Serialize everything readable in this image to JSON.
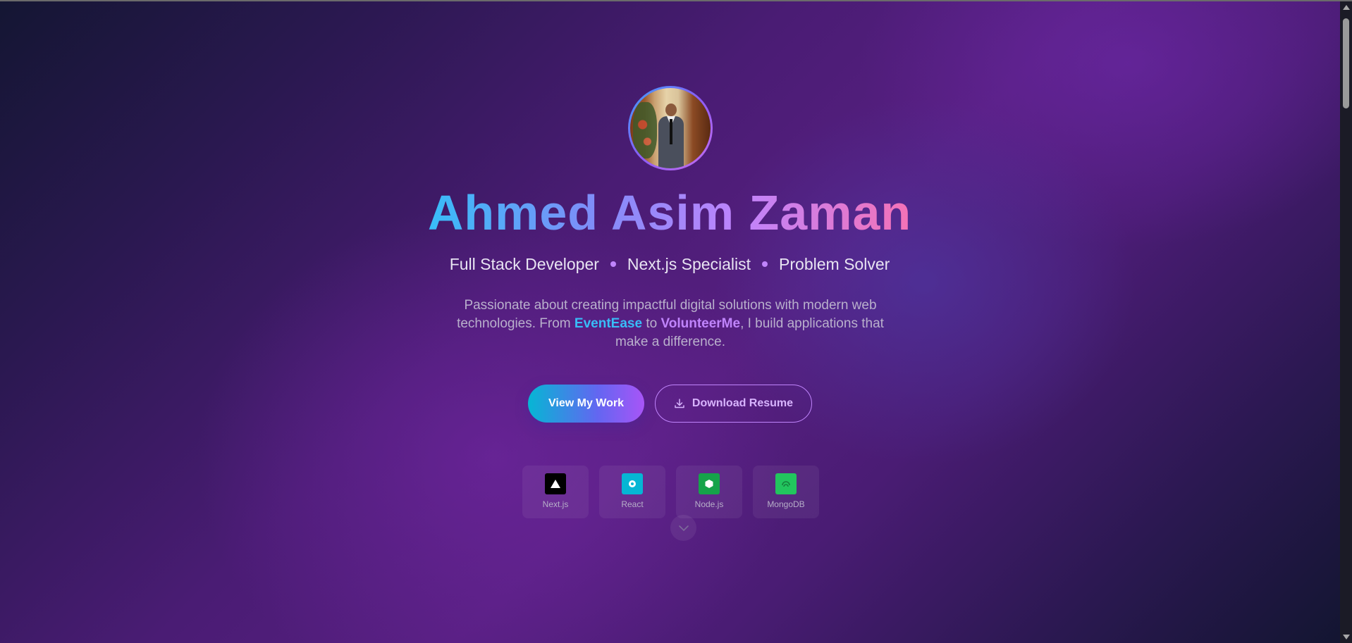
{
  "hero": {
    "name": "Ahmed Asim Zaman",
    "roles": [
      "Full Stack Developer",
      "Next.js Specialist",
      "Problem Solver"
    ],
    "description": {
      "part1": "Passionate about creating impactful digital solutions with modern web technologies. From ",
      "highlight1": "EventEase",
      "part2": " to ",
      "highlight2": "VolunteerMe",
      "part3": ", I build applications that make a difference."
    },
    "primary_button": "View My Work",
    "secondary_button": "Download Resume",
    "avatar_alt": "profile-photo"
  },
  "tech_stack": [
    {
      "label": "Next.js",
      "icon": "nextjs-icon",
      "color": "#000000"
    },
    {
      "label": "React",
      "icon": "react-icon",
      "color": "#06b6d4"
    },
    {
      "label": "Node.js",
      "icon": "nodejs-icon",
      "color": "#16a34a"
    },
    {
      "label": "MongoDB",
      "icon": "mongodb-icon",
      "color": "#22c55e"
    }
  ],
  "colors": {
    "accent_cyan": "#38bdf8",
    "accent_purple": "#c084fc",
    "accent_pink": "#f472b6"
  }
}
